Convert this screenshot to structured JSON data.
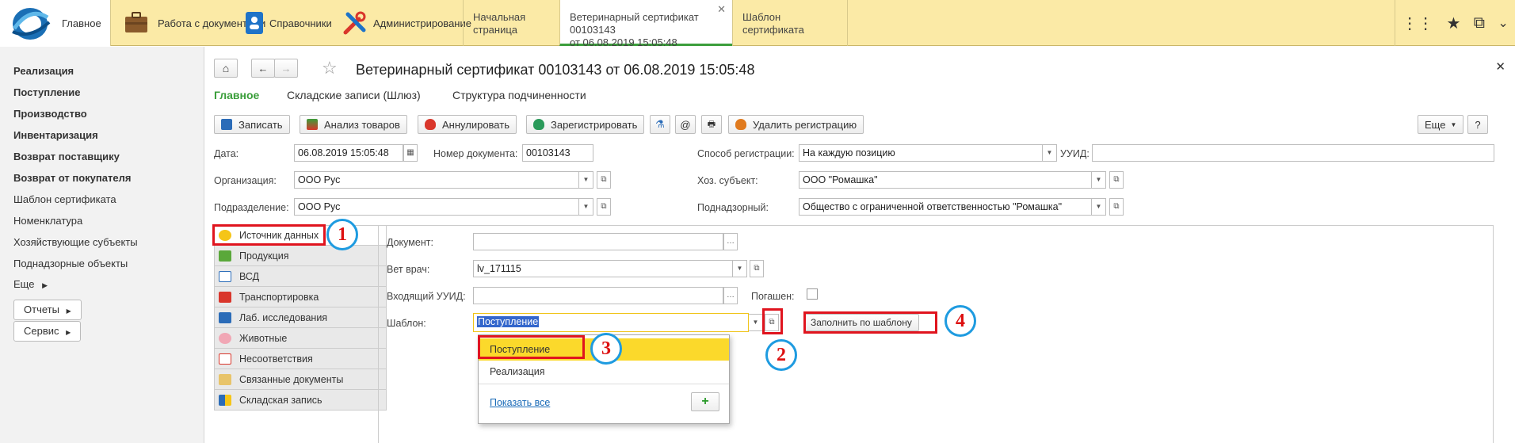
{
  "topbar": {
    "home_label": "Главное",
    "sections": [
      "Работа с документами",
      "Справочники",
      "Администрирование"
    ],
    "tabs": [
      {
        "label": "Начальная страница"
      },
      {
        "label_line1": "Ветеринарный сертификат 00103143",
        "label_line2": "от 06.08.2019 15:05:48",
        "active": true
      },
      {
        "label": "Шаблон сертификата"
      }
    ]
  },
  "sidebar": {
    "items": [
      "Реализация",
      "Поступление",
      "Производство",
      "Инвентаризация",
      "Возврат поставщику",
      "Возврат от покупателя",
      "Шаблон сертификата",
      "Номенклатура",
      "Хозяйствующие субъекты",
      "Поднадзорные объекты"
    ],
    "more": "Еще",
    "buttons": [
      "Отчеты",
      "Сервис"
    ]
  },
  "document": {
    "title": "Ветеринарный сертификат 00103143 от 06.08.2019 15:05:48",
    "nav_tabs": [
      "Главное",
      "Складские записи (Шлюз)",
      "Структура подчиненности"
    ],
    "toolbar": {
      "save": "Записать",
      "analyze": "Анализ товаров",
      "cancel": "Аннулировать",
      "register": "Зарегистрировать",
      "delete_reg": "Удалить регистрацию",
      "more": "Еще",
      "help": "?"
    },
    "fields": {
      "date_label": "Дата:",
      "date_value": "06.08.2019 15:05:48",
      "docnum_label": "Номер документа:",
      "docnum_value": "00103143",
      "regmethod_label": "Способ регистрации:",
      "regmethod_value": "На каждую позицию",
      "uuid_label": "УУИД:",
      "uuid_value": "",
      "org_label": "Организация:",
      "org_value": "ООО Рус",
      "subject_label": "Хоз. субъект:",
      "subject_value": "ООО \"Ромашка\"",
      "dept_label": "Подразделение:",
      "dept_value": "ООО Рус",
      "supervised_label": "Поднадзорный:",
      "supervised_value": "Общество с ограниченной ответственностью \"Ромашка\""
    },
    "sections": [
      "Источник данных",
      "Продукция",
      "ВСД",
      "Транспортировка",
      "Лаб. исследования",
      "Животные",
      "Несоответствия",
      "Связанные документы",
      "Складская запись"
    ],
    "source": {
      "doc_label": "Документ:",
      "doc_value": "",
      "vet_label": "Вет врач:",
      "vet_value": "lv_171115",
      "in_uuid_label": "Входящий УУИД:",
      "in_uuid_value": "",
      "extinguished_label": "Погашен:",
      "template_label": "Шаблон:",
      "template_value": "Поступление",
      "fill_button": "Заполнить по шаблону"
    },
    "dropdown": {
      "options": [
        "Поступление",
        "Реализация"
      ],
      "show_all": "Показать все",
      "add": "+"
    }
  },
  "annotations": [
    "1",
    "2",
    "3",
    "4"
  ]
}
